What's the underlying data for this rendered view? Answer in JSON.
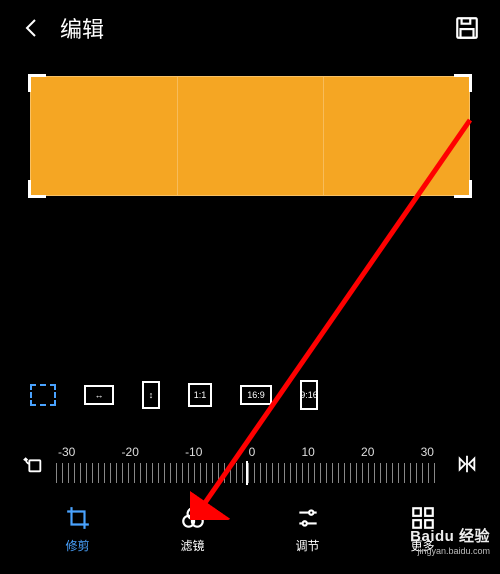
{
  "header": {
    "title": "编辑"
  },
  "aspect": {
    "items": [
      {
        "id": "free",
        "label": "",
        "active": true
      },
      {
        "id": "hor",
        "label": "↔"
      },
      {
        "id": "ver",
        "label": "↕"
      },
      {
        "id": "sq",
        "label": "1:1"
      },
      {
        "id": "wide",
        "label": "16:9"
      },
      {
        "id": "tall",
        "label": "9:16"
      }
    ]
  },
  "rotate": {
    "ticks": [
      "-30",
      "-20",
      "-10",
      "0",
      "10",
      "20",
      "30"
    ]
  },
  "tabs": {
    "items": [
      {
        "id": "crop",
        "label": "修剪",
        "active": true
      },
      {
        "id": "filter",
        "label": "滤镜",
        "active": false
      },
      {
        "id": "adjust",
        "label": "调节",
        "active": false
      },
      {
        "id": "more",
        "label": "更多",
        "active": false
      }
    ]
  },
  "watermark": {
    "line1": "Baidu 经验",
    "line2": "jingyan.baidu.com"
  },
  "colors": {
    "accent": "#4aa3ff",
    "crop_fill": "#f5a623",
    "arrow": "#ff0000"
  }
}
